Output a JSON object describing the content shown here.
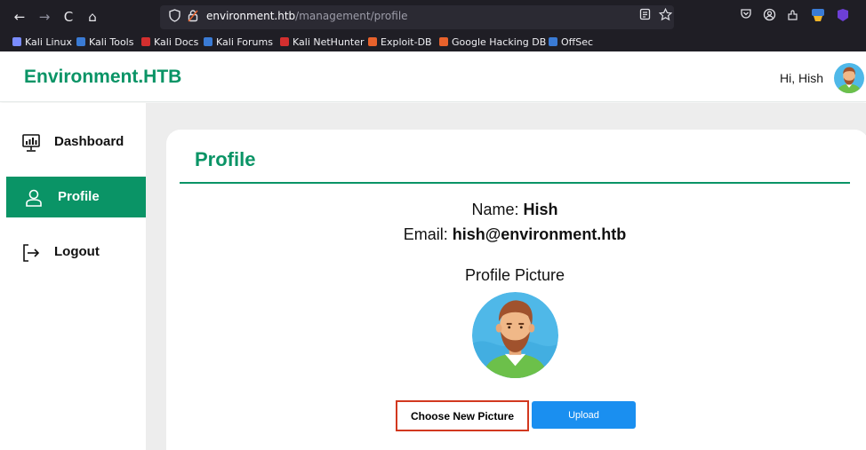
{
  "browser": {
    "nav": {
      "back": "←",
      "forward": "→",
      "reload": "C",
      "home": "⌂"
    },
    "url_host": "environment.htb",
    "url_path": "/management/profile",
    "bookmarks": [
      {
        "label": "Kali Linux",
        "color": "#7a8cff"
      },
      {
        "label": "Kali Tools",
        "color": "#3a7bd5"
      },
      {
        "label": "Kali Docs",
        "color": "#d32f2f"
      },
      {
        "label": "Kali Forums",
        "color": "#3a7bd5"
      },
      {
        "label": "Kali NetHunter",
        "color": "#d32f2f"
      },
      {
        "label": "Exploit-DB",
        "color": "#e8622c"
      },
      {
        "label": "Google Hacking DB",
        "color": "#e8622c"
      },
      {
        "label": "OffSec",
        "color": "#3a7bd5"
      }
    ]
  },
  "header": {
    "brand": "Environment.HTB",
    "greeting": "Hi, Hish"
  },
  "sidebar": {
    "items": [
      {
        "label": "Dashboard",
        "icon": "dashboard-monitor-icon",
        "active": false
      },
      {
        "label": "Profile",
        "icon": "user-icon",
        "active": true
      },
      {
        "label": "Logout",
        "icon": "logout-icon",
        "active": false
      }
    ]
  },
  "profile": {
    "title": "Profile",
    "name_label": "Name:",
    "name_value": "Hish",
    "email_label": "Email:",
    "email_value": "hish@environment.htb",
    "picture_label": "Profile Picture",
    "choose_button": "Choose New Picture",
    "upload_button": "Upload"
  },
  "colors": {
    "brand": "#0a9466",
    "upload": "#1a8ff0",
    "highlight": "#d2381f"
  }
}
